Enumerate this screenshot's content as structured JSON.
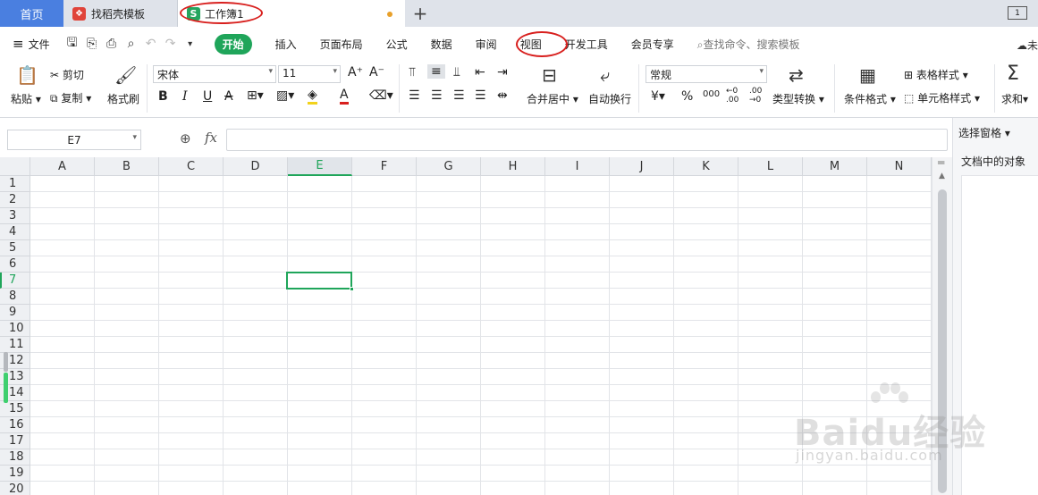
{
  "tabs": {
    "home": "首页",
    "doc": "找稻壳模板",
    "book": "工作簿1",
    "book_icon": "S",
    "doc_icon": "❖",
    "add": "+",
    "right_icon": "1"
  },
  "menubar": {
    "file": "文件",
    "items": [
      "开始",
      "插入",
      "页面布局",
      "公式",
      "数据",
      "审阅",
      "视图",
      "开发工具",
      "会员专享"
    ],
    "search": "查找命令、搜索模板",
    "right": "未"
  },
  "ribbon": {
    "paste": "粘贴",
    "cut": "剪切",
    "copy": "复制",
    "format_painter": "格式刷",
    "font_name": "宋体",
    "font_size": "11",
    "bold": "B",
    "italic": "I",
    "underline": "U",
    "merge": "合并居中",
    "wrap": "自动换行",
    "number_format": "常规",
    "currency": "¥",
    "percent": "%",
    "thousands": "000",
    "type_convert": "类型转换",
    "cond_format": "条件格式",
    "table_style": "表格样式",
    "cell_style": "单元格样式",
    "sum": "求和"
  },
  "formula_bar": {
    "name_box": "E7",
    "fx": "fx",
    "value": ""
  },
  "side_pane": {
    "title": "选择窗格",
    "subtitle": "文档中的对象"
  },
  "sheet": {
    "columns": [
      "A",
      "B",
      "C",
      "D",
      "E",
      "F",
      "G",
      "H",
      "I",
      "J",
      "K",
      "L",
      "M",
      "N"
    ],
    "rows": [
      "1",
      "2",
      "3",
      "4",
      "5",
      "6",
      "7",
      "8",
      "9",
      "10",
      "11",
      "12",
      "13",
      "14",
      "15",
      "16",
      "17",
      "18",
      "19",
      "20"
    ],
    "active_column": "E",
    "active_row": "7"
  },
  "watermark": {
    "brand": "Baidu经验",
    "url": "jingyan.baidu.com"
  },
  "colors": {
    "accent": "#1fa55a",
    "home_tab": "#4a7fe0",
    "annotation": "#d8201e"
  }
}
